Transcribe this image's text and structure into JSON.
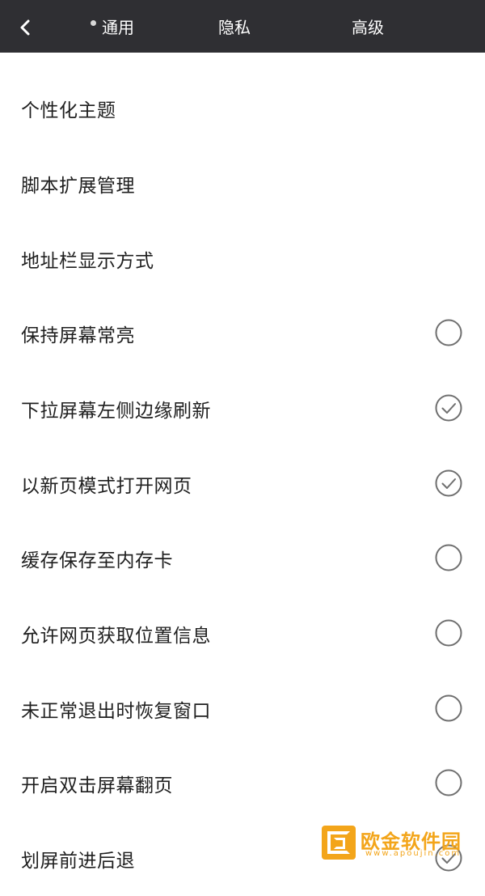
{
  "header": {
    "back_icon": "chevron-left-icon",
    "tabs": [
      {
        "label": "通用",
        "active": true
      },
      {
        "label": "隐私",
        "active": false
      },
      {
        "label": "高级",
        "active": false
      }
    ]
  },
  "settings": {
    "items": [
      {
        "label": "个性化主题",
        "has_toggle": false
      },
      {
        "label": "脚本扩展管理",
        "has_toggle": false
      },
      {
        "label": "地址栏显示方式",
        "has_toggle": false
      },
      {
        "label": "保持屏幕常亮",
        "has_toggle": true,
        "checked": false
      },
      {
        "label": "下拉屏幕左侧边缘刷新",
        "has_toggle": true,
        "checked": true
      },
      {
        "label": "以新页模式打开网页",
        "has_toggle": true,
        "checked": true
      },
      {
        "label": "缓存保存至内存卡",
        "has_toggle": true,
        "checked": false
      },
      {
        "label": "允许网页获取位置信息",
        "has_toggle": true,
        "checked": false
      },
      {
        "label": "未正常退出时恢复窗口",
        "has_toggle": true,
        "checked": false
      },
      {
        "label": "开启双击屏幕翻页",
        "has_toggle": true,
        "checked": false
      },
      {
        "label": "划屏前进后退",
        "has_toggle": true,
        "checked": true
      }
    ]
  },
  "watermark": {
    "title": "欧金软件园",
    "subtitle": "www.apoujin.com"
  },
  "colors": {
    "header_bg": "#2f2f33",
    "text": "#1f1f1f",
    "check_stroke": "#6f6f6f",
    "watermark": "#f3a51a"
  }
}
